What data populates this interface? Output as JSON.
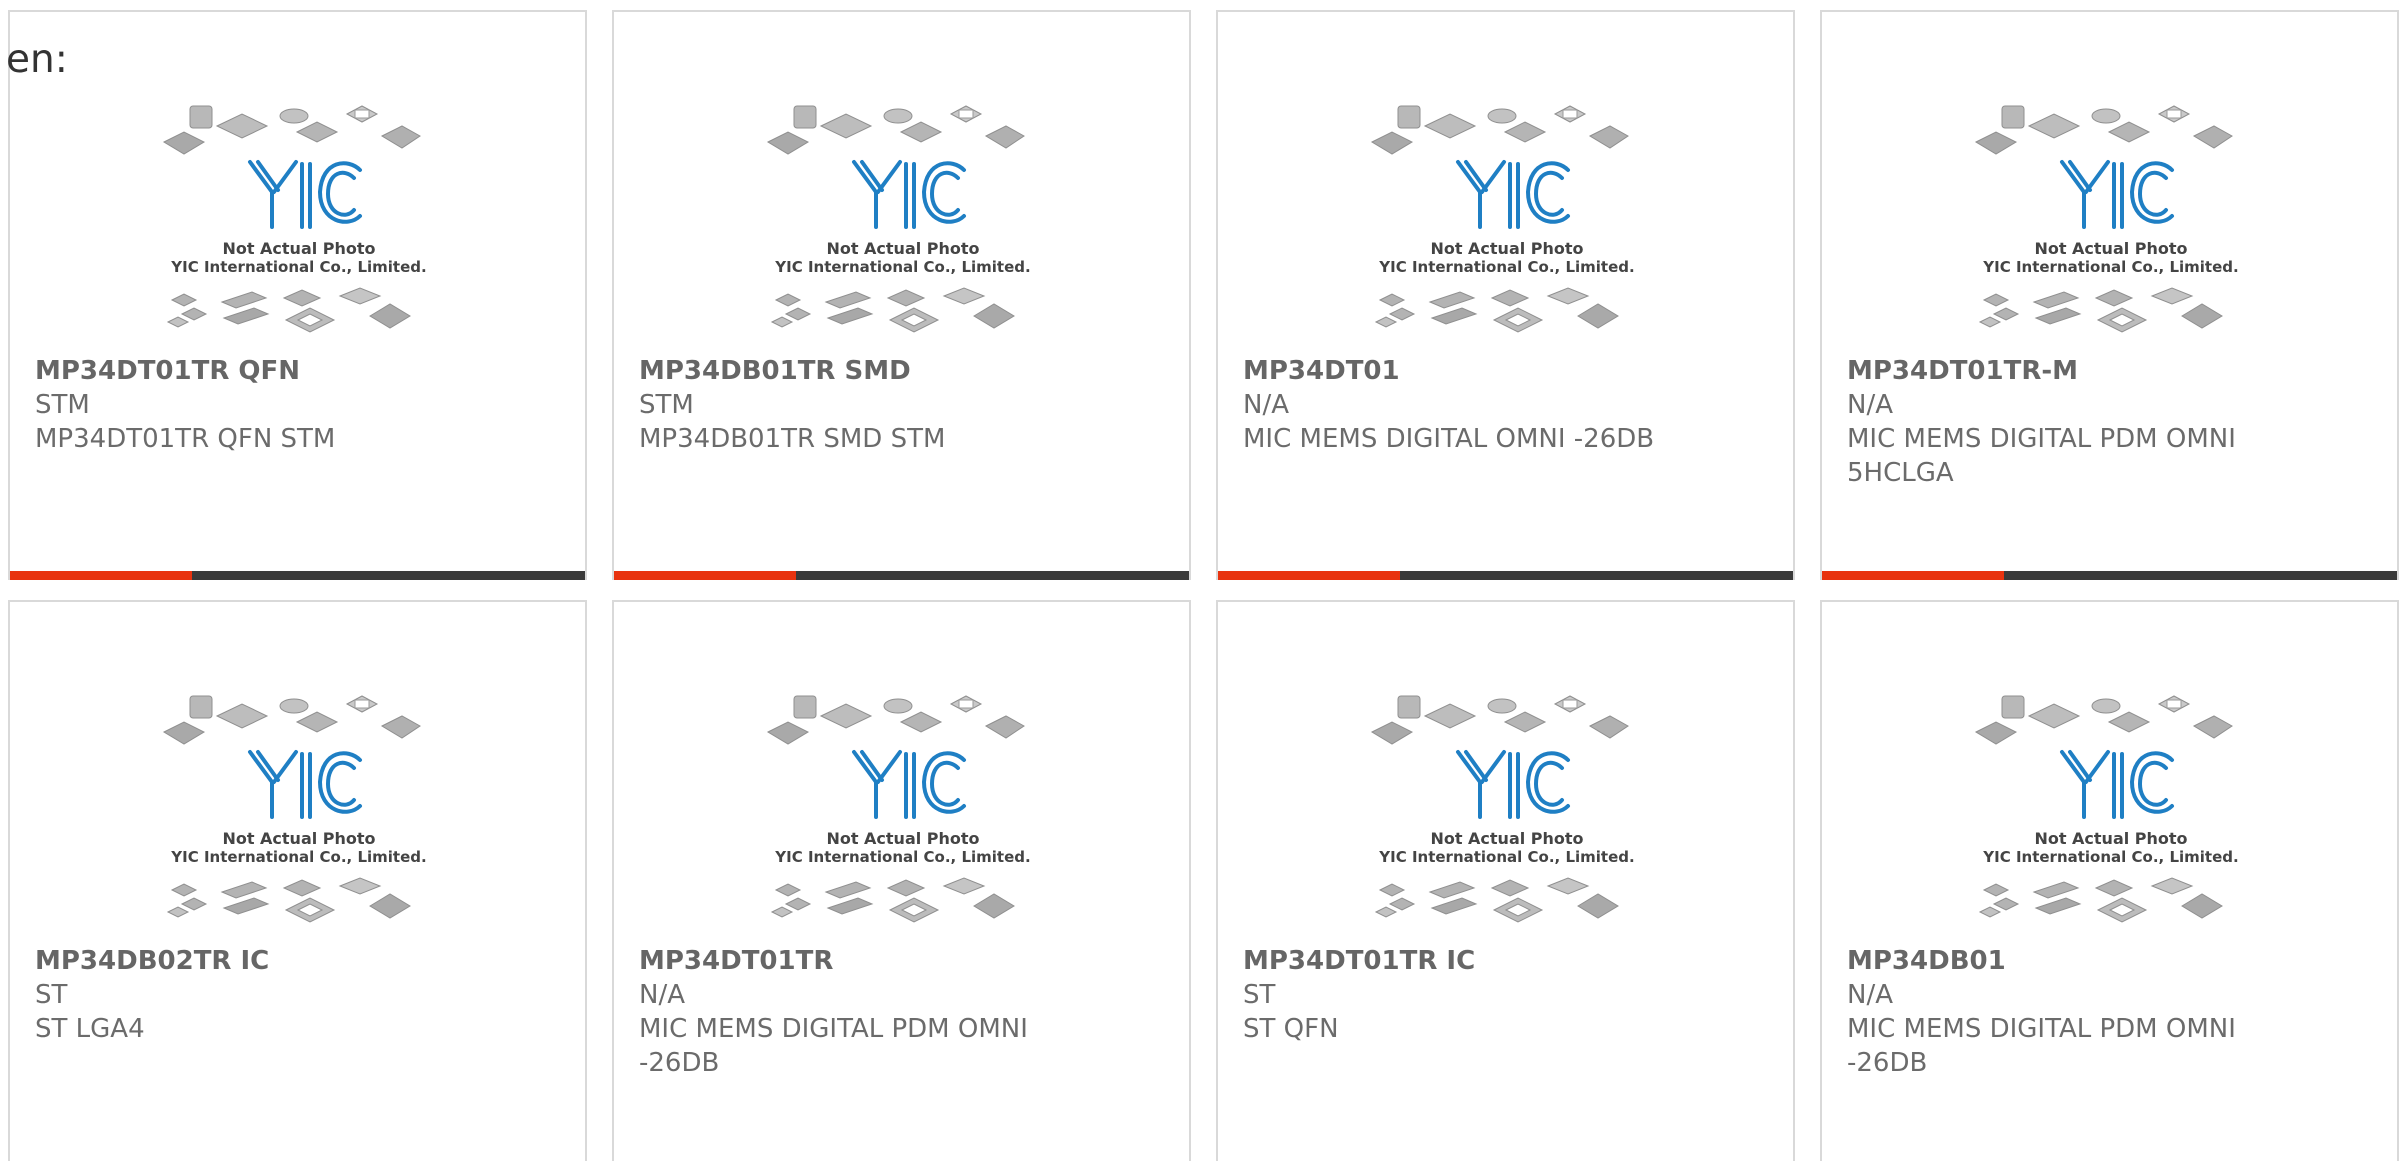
{
  "lang_label": "en:",
  "thumbnail": {
    "caption_line1": "Not Actual Photo",
    "caption_line2": "YIC International Co., Limited.",
    "logo_text": "YIC"
  },
  "colors": {
    "accent": "#e8330f",
    "bar_dark": "#3a3a3a",
    "logo_blue": "#1f7fc4",
    "text": "#6b6b6b"
  },
  "products": [
    {
      "part": "MP34DT01TR QFN",
      "maker": "STM",
      "desc": "MP34DT01TR QFN STM"
    },
    {
      "part": "MP34DB01TR SMD",
      "maker": "STM",
      "desc": "MP34DB01TR SMD STM"
    },
    {
      "part": "MP34DT01",
      "maker": "N/A",
      "desc": "MIC MEMS DIGITAL OMNI -26DB"
    },
    {
      "part": "MP34DT01TR-M",
      "maker": "N/A",
      "desc": "MIC MEMS DIGITAL PDM OMNI 5HCLGA"
    },
    {
      "part": "MP34DB02TR IC",
      "maker": "ST",
      "desc": "ST LGA4"
    },
    {
      "part": "MP34DT01TR",
      "maker": "N/A",
      "desc": "MIC MEMS DIGITAL PDM OMNI -26DB"
    },
    {
      "part": "MP34DT01TR IC",
      "maker": "ST",
      "desc": "ST QFN"
    },
    {
      "part": "MP34DB01",
      "maker": "N/A",
      "desc": "MIC MEMS DIGITAL PDM OMNI -26DB"
    }
  ]
}
